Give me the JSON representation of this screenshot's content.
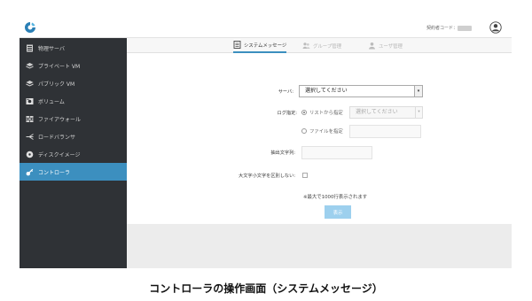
{
  "header": {
    "contract_label": "契約者コード：",
    "contract_masked": "■■■"
  },
  "sidebar": {
    "items": [
      {
        "label": "物理サーバ",
        "icon": "server-icon",
        "active": false
      },
      {
        "label": "プライベート VM",
        "icon": "layers-icon",
        "active": false
      },
      {
        "label": "パブリック VM",
        "icon": "layers-icon",
        "active": false
      },
      {
        "label": "ボリューム",
        "icon": "disk-icon",
        "active": false
      },
      {
        "label": "ファイアウォール",
        "icon": "firewall-icon",
        "active": false
      },
      {
        "label": "ロードバランサ",
        "icon": "load-balancer-icon",
        "active": false
      },
      {
        "label": "ディスクイメージ",
        "icon": "disc-icon",
        "active": false
      },
      {
        "label": "コントローラ",
        "icon": "key-icon",
        "active": true
      }
    ],
    "active_color": "#3c8fbf"
  },
  "tabs": [
    {
      "label": "システムメッセージ",
      "icon": "document-icon",
      "active": true
    },
    {
      "label": "グループ管理",
      "icon": "group-icon",
      "active": false
    },
    {
      "label": "ユーザ管理",
      "icon": "user-icon",
      "active": false
    }
  ],
  "form": {
    "server_label": "サーバ:",
    "server_value": "選択してください",
    "log_label": "ログ指定:",
    "radio_list_label": "リストから指定",
    "list_select_value": "選択してください",
    "radio_file_label": "ファイルを指定",
    "extract_label": "抽出文字列:",
    "case_label": "大文字小文字を区別しない:",
    "note": "※最大で1000行表示されます",
    "show_button": "表示"
  },
  "caption": "コントローラの操作画面（システムメッセージ）"
}
